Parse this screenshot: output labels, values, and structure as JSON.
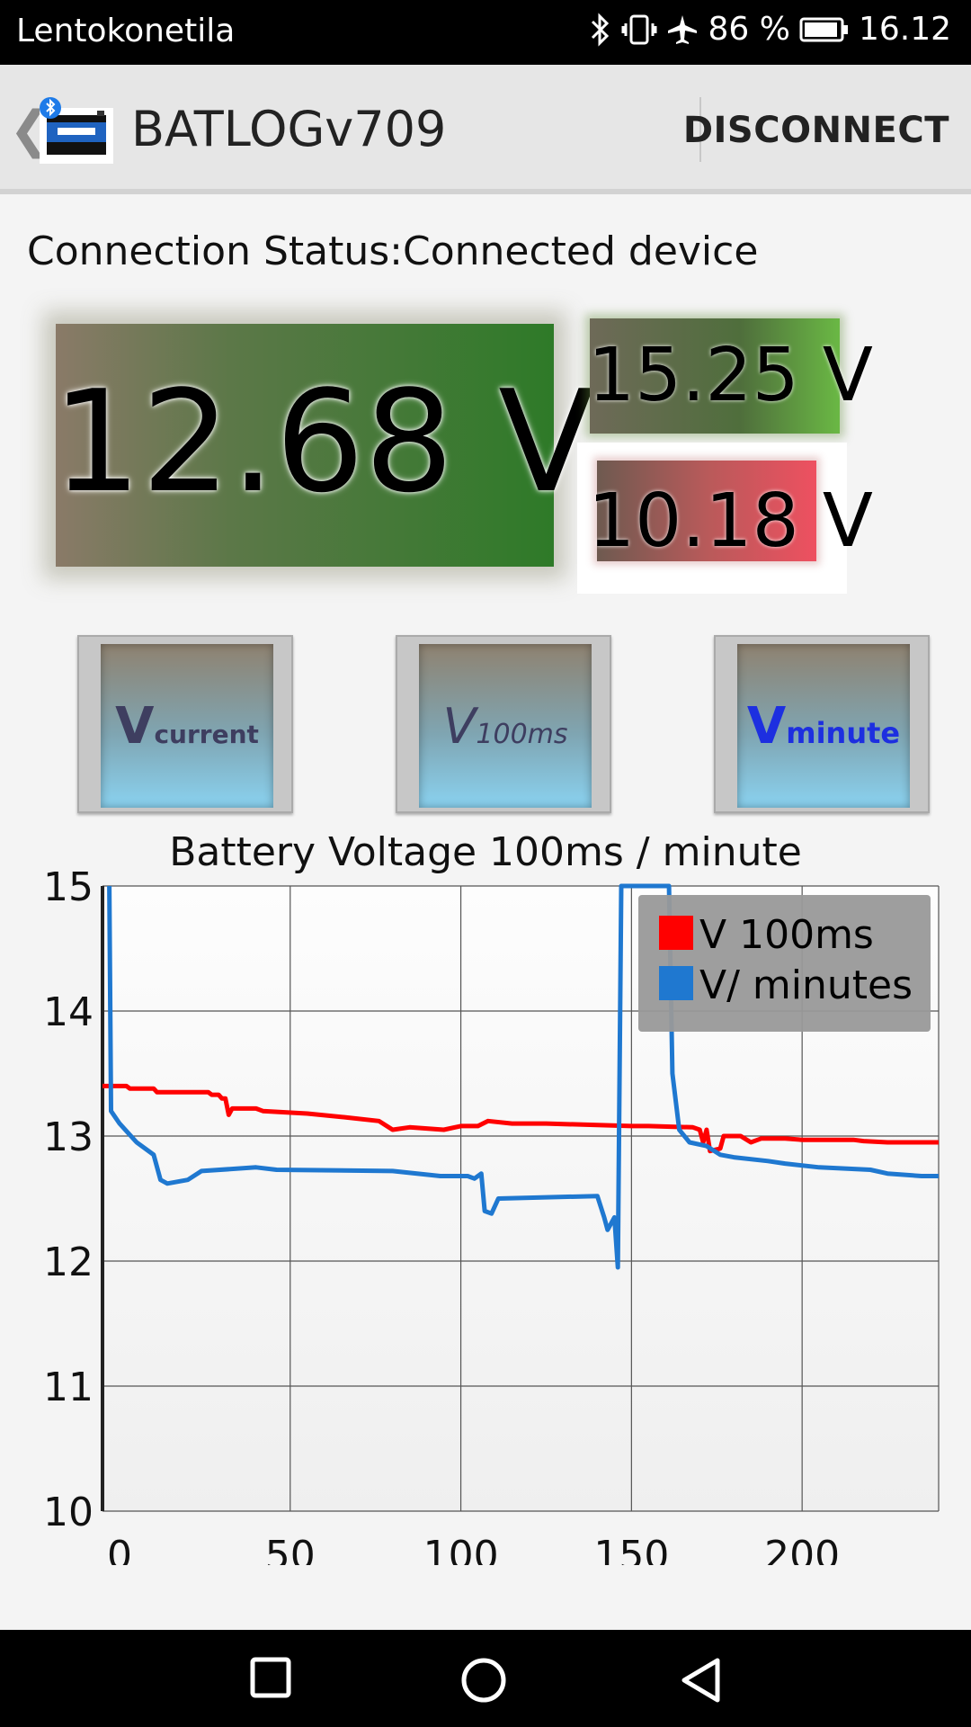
{
  "status_bar": {
    "carrier": "Lentokonetila",
    "battery_percent": "86 %",
    "time": "16.12",
    "icons": [
      "bluetooth-icon",
      "vibrate-icon",
      "airplane-icon",
      "battery-icon"
    ]
  },
  "action_bar": {
    "title": "BATLOGv709",
    "disconnect_label": "DISCONNECT",
    "icons": [
      "back-chevron-icon",
      "car-battery-app-icon",
      "bluetooth-badge-icon"
    ]
  },
  "connection": {
    "status_text": "Connection Status:Connected device"
  },
  "voltages": {
    "current": "12.68 V",
    "max": "15.25 V",
    "min": "10.18 V"
  },
  "mode_buttons": {
    "vcurrent": {
      "big": "V",
      "small": "current"
    },
    "v100ms": {
      "big": "V",
      "small": "100ms"
    },
    "vminute": {
      "big": "V",
      "small": "minute"
    }
  },
  "colors": {
    "series_100ms": "#ff0000",
    "series_minutes": "#1f78d0",
    "legend_bg": "#999999"
  },
  "chart_data": {
    "type": "line",
    "title": "Battery Voltage 100ms / minute",
    "xlabel": "",
    "ylabel": "",
    "xlim": [
      -5,
      240
    ],
    "ylim": [
      10,
      15
    ],
    "x_ticks": [
      0,
      50,
      100,
      150,
      200
    ],
    "y_ticks": [
      10,
      11,
      12,
      13,
      14,
      15
    ],
    "grid": true,
    "legend_position": "top-right",
    "series": [
      {
        "name": "V 100ms",
        "color": "#ff0000",
        "points": [
          [
            -5,
            13.4
          ],
          [
            2,
            13.4
          ],
          [
            3,
            13.38
          ],
          [
            10,
            13.38
          ],
          [
            11,
            13.35
          ],
          [
            26,
            13.35
          ],
          [
            27,
            13.33
          ],
          [
            29,
            13.33
          ],
          [
            30,
            13.3
          ],
          [
            31,
            13.3
          ],
          [
            32,
            13.17
          ],
          [
            33,
            13.22
          ],
          [
            40,
            13.22
          ],
          [
            42,
            13.2
          ],
          [
            55,
            13.18
          ],
          [
            66,
            13.15
          ],
          [
            76,
            13.12
          ],
          [
            80,
            13.05
          ],
          [
            85,
            13.07
          ],
          [
            95,
            13.05
          ],
          [
            100,
            13.08
          ],
          [
            105,
            13.08
          ],
          [
            108,
            13.12
          ],
          [
            115,
            13.1
          ],
          [
            125,
            13.1
          ],
          [
            150,
            13.08
          ],
          [
            155,
            13.08
          ],
          [
            168,
            13.07
          ],
          [
            170,
            13.05
          ],
          [
            171,
            12.95
          ],
          [
            172,
            13.05
          ],
          [
            173,
            12.88
          ],
          [
            176,
            12.9
          ],
          [
            177,
            13.0
          ],
          [
            182,
            13.0
          ],
          [
            185,
            12.95
          ],
          [
            188,
            12.98
          ],
          [
            195,
            12.98
          ],
          [
            200,
            12.97
          ],
          [
            215,
            12.97
          ],
          [
            218,
            12.96
          ],
          [
            225,
            12.95
          ],
          [
            235,
            12.95
          ],
          [
            240,
            12.95
          ]
        ]
      },
      {
        "name": "V/ minutes",
        "color": "#1f78d0",
        "points": [
          [
            -3,
            15.0
          ],
          [
            -2.5,
            13.2
          ],
          [
            0,
            13.1
          ],
          [
            5,
            12.95
          ],
          [
            10,
            12.85
          ],
          [
            12,
            12.65
          ],
          [
            14,
            12.62
          ],
          [
            20,
            12.65
          ],
          [
            24,
            12.72
          ],
          [
            40,
            12.75
          ],
          [
            46,
            12.73
          ],
          [
            80,
            12.72
          ],
          [
            94,
            12.68
          ],
          [
            102,
            12.68
          ],
          [
            104,
            12.66
          ],
          [
            106,
            12.7
          ],
          [
            107,
            12.4
          ],
          [
            109,
            12.38
          ],
          [
            111,
            12.5
          ],
          [
            140,
            12.52
          ],
          [
            142,
            12.35
          ],
          [
            143,
            12.25
          ],
          [
            145,
            12.35
          ],
          [
            146,
            11.95
          ],
          [
            147,
            15.0
          ],
          [
            148,
            15.0
          ],
          [
            161,
            15.0
          ],
          [
            162,
            13.5
          ],
          [
            164,
            13.05
          ],
          [
            167,
            12.95
          ],
          [
            172,
            12.92
          ],
          [
            176,
            12.85
          ],
          [
            180,
            12.83
          ],
          [
            190,
            12.8
          ],
          [
            195,
            12.78
          ],
          [
            205,
            12.75
          ],
          [
            220,
            12.73
          ],
          [
            225,
            12.7
          ],
          [
            235,
            12.68
          ],
          [
            240,
            12.68
          ]
        ]
      }
    ]
  }
}
